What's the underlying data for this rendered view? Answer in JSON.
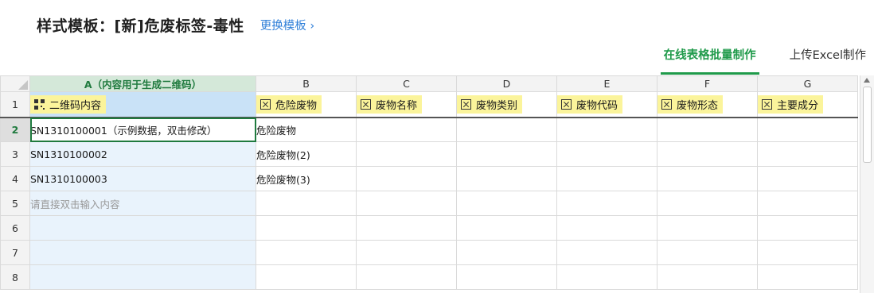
{
  "header": {
    "title": "样式模板：[新]危废标签-毒性",
    "change_link": "更换模板 ›"
  },
  "tabs": [
    {
      "label": "在线表格批量制作",
      "active": true
    },
    {
      "label": "上传Excel制作",
      "active": false
    }
  ],
  "sheet": {
    "columns": [
      "A（内容用于生成二维码）",
      "B",
      "C",
      "D",
      "E",
      "F",
      "G"
    ],
    "row_numbers": [
      "1",
      "2",
      "3",
      "4",
      "5",
      "6",
      "7",
      "8"
    ],
    "field_headers": [
      {
        "label": "二维码内容",
        "icon": "qr-code-icon"
      },
      {
        "label": "危险废物",
        "icon": "field-box-icon"
      },
      {
        "label": "废物名称",
        "icon": "field-box-icon"
      },
      {
        "label": "废物类别",
        "icon": "field-box-icon"
      },
      {
        "label": "废物代码",
        "icon": "field-box-icon"
      },
      {
        "label": "废物形态",
        "icon": "field-box-icon"
      },
      {
        "label": "主要成分",
        "icon": "field-box-icon"
      }
    ],
    "rows": [
      [
        "SN1310100001（示例数据，双击修改）",
        "危险废物",
        "",
        "",
        "",
        "",
        ""
      ],
      [
        "SN1310100002",
        "危险废物(2)",
        "",
        "",
        "",
        "",
        ""
      ],
      [
        "SN1310100003",
        "危险废物(3)",
        "",
        "",
        "",
        "",
        ""
      ],
      [
        "请直接双击输入内容",
        "",
        "",
        "",
        "",
        "",
        ""
      ],
      [
        "",
        "",
        "",
        "",
        "",
        "",
        ""
      ],
      [
        "",
        "",
        "",
        "",
        "",
        "",
        ""
      ],
      [
        "",
        "",
        "",
        "",
        "",
        "",
        ""
      ]
    ]
  },
  "colors": {
    "accent": "#1f9a4a",
    "link": "#2f7fd8",
    "header_chip": "#fbf49b",
    "selected_column": "#e9f3fc"
  }
}
